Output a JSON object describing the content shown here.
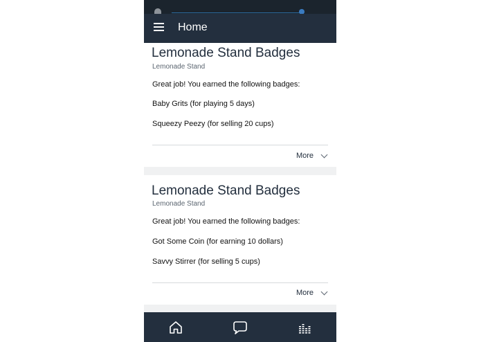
{
  "header": {
    "title": "Home",
    "menu_icon": "hamburger-menu-icon"
  },
  "feed": {
    "cards": [
      {
        "title": "Lemonade Stand Badges",
        "subtitle": "Lemonade Stand",
        "lines": [
          "Great job! You earned the following badges:",
          "Baby Grits (for playing 5 days)",
          "Squeezy Peezy (for selling 20 cups)"
        ],
        "more_label": "More"
      },
      {
        "title": "Lemonade Stand Badges",
        "subtitle": "Lemonade Stand",
        "lines": [
          "Great job! You earned the following badges:",
          "Got Some Coin (for earning 10 dollars)",
          "Savvy Stirrer (for selling 5 cups)"
        ],
        "more_label": "More"
      }
    ]
  },
  "bottom_nav": {
    "items": [
      {
        "icon": "home-icon"
      },
      {
        "icon": "chat-icon"
      },
      {
        "icon": "equalizer-icon"
      }
    ]
  },
  "colors": {
    "header_bg": "#232f3e",
    "status_bar_bg": "#1b242d",
    "separator_bg": "#f0f1f2",
    "text_dark": "#111111",
    "subtitle_gray": "#5b6570"
  }
}
